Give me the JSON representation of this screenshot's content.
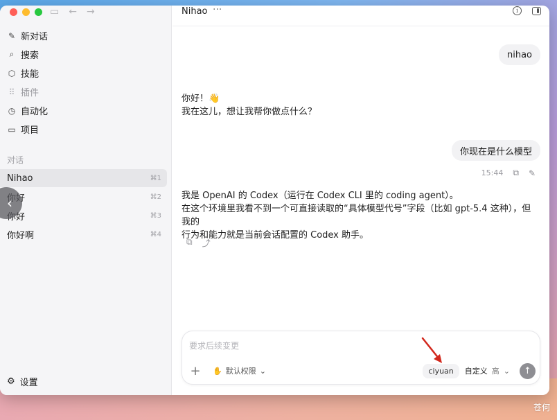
{
  "sidebar": {
    "nav": [
      {
        "label": "新对话",
        "icon": "edit-icon"
      },
      {
        "label": "搜索",
        "icon": "search-icon"
      },
      {
        "label": "技能",
        "icon": "cube-icon"
      },
      {
        "label": "插件",
        "icon": "grid-icon",
        "disabled": true
      },
      {
        "label": "自动化",
        "icon": "clock-icon"
      },
      {
        "label": "项目",
        "icon": "folder-icon"
      }
    ],
    "section_label": "对话",
    "conversations": [
      {
        "title": "Nihao",
        "shortcut": "⌘1",
        "active": true
      },
      {
        "title": "你好",
        "shortcut": "⌘2"
      },
      {
        "title": "你好",
        "shortcut": "⌘3"
      },
      {
        "title": "你好啊",
        "shortcut": "⌘4"
      }
    ],
    "settings_label": "设置"
  },
  "header": {
    "title": "Nihao",
    "more": "···"
  },
  "messages": {
    "user1": "nihao",
    "assistant1_line1": "你好！👋",
    "assistant1_line2": "我在这儿，想让我帮你做点什么？",
    "user2": "你现在是什么模型",
    "user2_time": "15:44",
    "assistant2_line1": "我是 OpenAI 的 Codex（运行在 Codex CLI 里的 coding agent）。",
    "assistant2_line2": "在这个环境里我看不到一个可直接读取的“具体模型代号”字段（比如  gpt-5.4  这种），但我的",
    "assistant2_line3": "行为和能力就是当前会话配置的 Codex 助手。"
  },
  "composer": {
    "placeholder": "要求后续变更",
    "permission_label": "默认权限",
    "model": "ciyuan",
    "custom_label": "自定义",
    "level": "高"
  },
  "watermark": "苍何"
}
